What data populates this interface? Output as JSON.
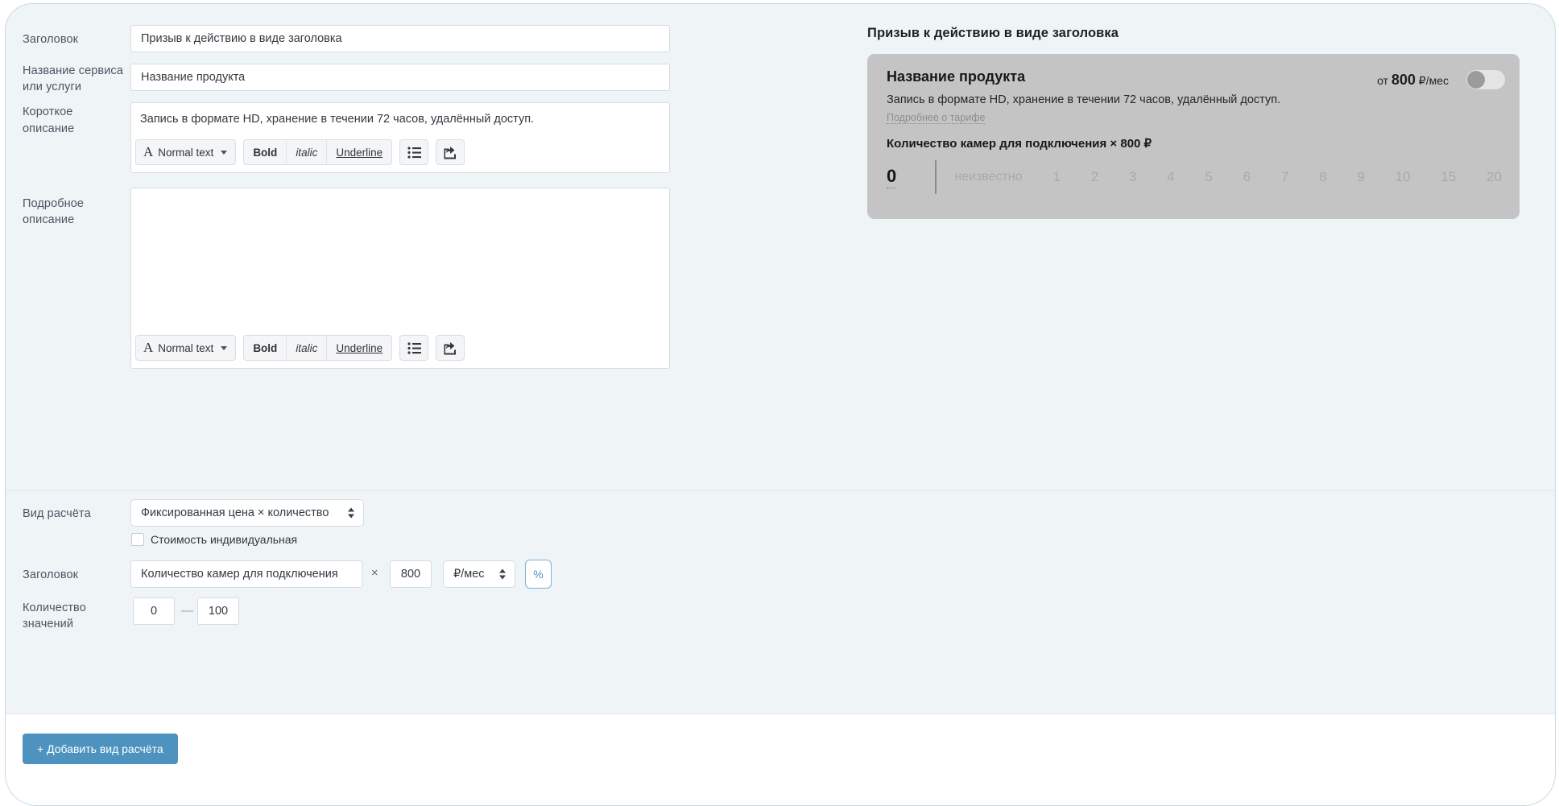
{
  "form": {
    "title_label": "Заголовок",
    "title_value": "Призыв к действию в виде заголовка",
    "service_label": "Название сервиса\nили услуги",
    "service_label_line1": "Название сервиса",
    "service_label_line2": "или услуги",
    "service_value": "Название продукта",
    "short_label_line1": "Короткое",
    "short_label_line2": "описание",
    "short_value": "Запись в формате HD, хранение в течении 72 часов, удалённый доступ.",
    "long_label_line1": "Подробное",
    "long_label_line2": "описание",
    "long_value": ""
  },
  "toolbar": {
    "normal_text": "Normal text",
    "bold": "Bold",
    "italic": "italic",
    "underline": "Underline",
    "list_icon": "bullet-list-icon",
    "embed_icon": "share-export-icon",
    "serif_a": "A"
  },
  "preview": {
    "heading": "Призыв к действию в виде заголовка",
    "card": {
      "product_name": "Название продукта",
      "price_prefix": "от",
      "price_value": "800",
      "price_unit": "₽/мес",
      "description": "Запись в формате HD, хранение в течении 72 часов, удалённый доступ.",
      "more_link": "Подробнее о тарифе",
      "row_title": "Количество камер для подключения × 800 ₽",
      "current_value": "0",
      "options": [
        "неизвестно",
        "1",
        "2",
        "3",
        "4",
        "5",
        "6",
        "7",
        "8",
        "9",
        "10",
        "15",
        "20"
      ],
      "toggle_state": "off",
      "card_bg": "#c4c4c4"
    }
  },
  "calc": {
    "type_label": "Вид расчёта",
    "type_value": "Фиксированная цена × количество",
    "individual_label": "Стоимость индивидуальная",
    "individual_checked": false,
    "row_title_label": "Заголовок",
    "row_title_value": "Количество камер для подключения",
    "multiply_sign": "×",
    "amount_value": "800",
    "unit_value": "₽/мес",
    "percent_button": "%",
    "count_label_line1": "Количество",
    "count_label_line2": "значений",
    "min_value": "0",
    "range_dash": "—",
    "max_value": "100"
  },
  "footer": {
    "add_button": "+ Добавить вид расчёта",
    "accent_color": "#4e93bf"
  }
}
